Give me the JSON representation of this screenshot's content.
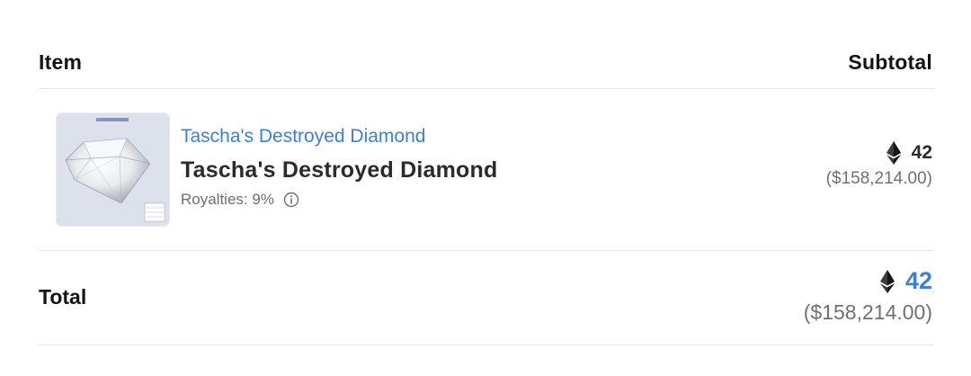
{
  "header": {
    "item_label": "Item",
    "subtotal_label": "Subtotal"
  },
  "line_item": {
    "thumbnail_icon": "diamond-image",
    "collection_name": "Tascha's Destroyed Diamond",
    "item_name": "Tascha's Destroyed Diamond",
    "royalties_text": "Royalties: 9%",
    "info_icon": "info-circle-icon",
    "currency_icon": "ethereum-icon",
    "eth_amount": "42",
    "usd_amount": "($158,214.00)"
  },
  "total": {
    "label": "Total",
    "currency_icon": "ethereum-icon",
    "eth_amount": "42",
    "usd_amount": "($158,214.00)"
  },
  "colors": {
    "link": "#3a80d9",
    "text": "#2b2b2b",
    "muted": "#707070",
    "divider": "#e6e6e6"
  }
}
